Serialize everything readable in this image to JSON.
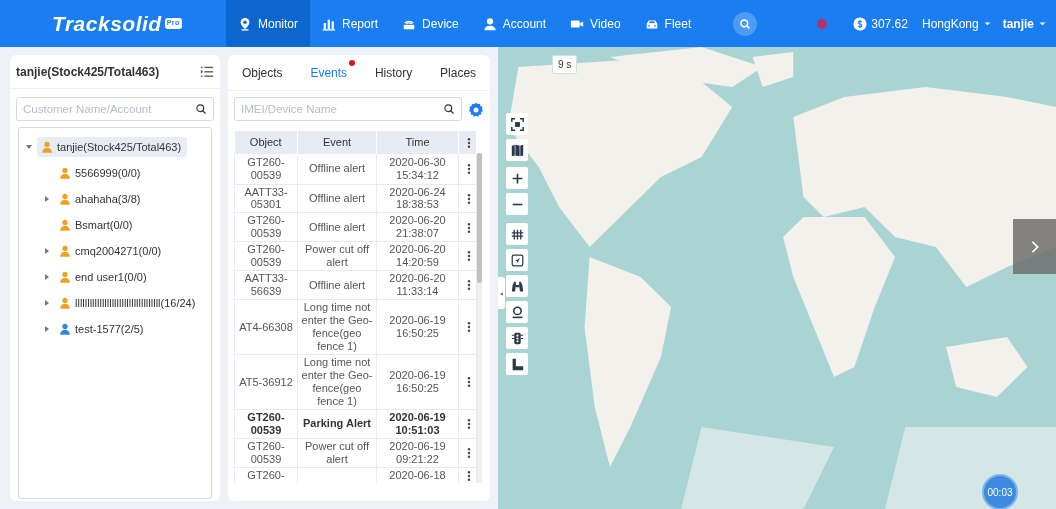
{
  "logo": {
    "name": "Tracksolid",
    "badge": "Pro"
  },
  "nav": [
    {
      "label": "Monitor",
      "selected": true
    },
    {
      "label": "Report",
      "selected": false
    },
    {
      "label": "Device",
      "selected": false
    },
    {
      "label": "Account",
      "selected": false
    },
    {
      "label": "Video",
      "selected": false
    },
    {
      "label": "Fleet",
      "selected": false
    }
  ],
  "header_right": {
    "notification": true,
    "balance": "307.62",
    "region": "HongKong",
    "user": "tanjie"
  },
  "customer_panel": {
    "title": "tanjie(Stock425/Total463)",
    "search": {
      "placeholder": "Customer Name/Account"
    },
    "tree": [
      {
        "label": "tanjie(Stock425/Total463)",
        "color": "#f0a020",
        "expanded": true,
        "selected": true,
        "children": [
          {
            "label": "5566999(0/0)",
            "color": "#f0a020",
            "selected": false,
            "has_children": false
          },
          {
            "label": "ahahaha(3/8)",
            "color": "#f0a020",
            "expanded": false,
            "selected": false,
            "has_children": true
          },
          {
            "label": "Bsmart(0/0)",
            "color": "#f0a020",
            "selected": false,
            "has_children": false
          },
          {
            "label": "cmq2004271(0/0)",
            "color": "#f0a020",
            "expanded": false,
            "selected": false,
            "has_children": true
          },
          {
            "label": "end user1(0/0)",
            "color": "#f0a020",
            "expanded": false,
            "selected": false,
            "has_children": true
          },
          {
            "label": "lllllllllllllllllllllllllllllllllll(16/24)",
            "color": "#f0a020",
            "expanded": false,
            "selected": false,
            "has_children": true
          },
          {
            "label": "test-1577(2/5)",
            "color": "#2b8ae0",
            "expanded": false,
            "selected": false,
            "has_children": true
          }
        ]
      }
    ]
  },
  "events_panel": {
    "tabs": [
      {
        "label": "Objects",
        "selected": false,
        "dot": false
      },
      {
        "label": "Events",
        "selected": true,
        "dot": true
      },
      {
        "label": "History",
        "selected": false,
        "dot": false
      },
      {
        "label": "Places",
        "selected": false,
        "dot": false
      }
    ],
    "search": {
      "placeholder": "IMEI/Device Name"
    },
    "table": {
      "columns": [
        "Object",
        "Event",
        "Time"
      ],
      "rows": [
        {
          "object": "GT260-00539",
          "event": "Offline alert",
          "time": "2020-06-30 15:34:12",
          "unread": false
        },
        {
          "object": "AATT33-05301",
          "event": "Offline alert",
          "time": "2020-06-24 18:38:53",
          "unread": false
        },
        {
          "object": "GT260-00539",
          "event": "Offline alert",
          "time": "2020-06-20 21:38:07",
          "unread": false
        },
        {
          "object": "GT260-00539",
          "event": "Power cut off alert",
          "time": "2020-06-20 14:20:59",
          "unread": false
        },
        {
          "object": "AATT33-56639",
          "event": "Offline alert",
          "time": "2020-06-20 11:33:14",
          "unread": false
        },
        {
          "object": "AT4-66308",
          "event": "Long time not enter the Geo-fence(geo fence 1)",
          "time": "2020-06-19 16:50:25",
          "unread": false
        },
        {
          "object": "AT5-36912",
          "event": "Long time not enter the Geo-fence(geo fence 1)",
          "time": "2020-06-19 16:50:25",
          "unread": false
        },
        {
          "object": "GT260-00539",
          "event": "Parking Alert",
          "time": "2020-06-19 10:51:03",
          "unread": true
        },
        {
          "object": "GT260-00539",
          "event": "Power cut off alert",
          "time": "2020-06-19 09:21:22",
          "unread": false
        },
        {
          "object": "GT260-",
          "time": "2020-06-18",
          "unread": false
        }
      ]
    }
  },
  "map": {
    "kind": "picture",
    "refresh": "9 s",
    "timer": "00:03",
    "tools": [
      {
        "kind": "fit"
      },
      {
        "kind": "layers"
      },
      {
        "kind": "zoom-in"
      },
      {
        "kind": "zoom-out"
      },
      {
        "kind": "grid"
      },
      {
        "kind": "compass"
      },
      {
        "kind": "binoculars"
      },
      {
        "kind": "marker"
      },
      {
        "kind": "traffic"
      },
      {
        "kind": "ruler"
      }
    ]
  }
}
